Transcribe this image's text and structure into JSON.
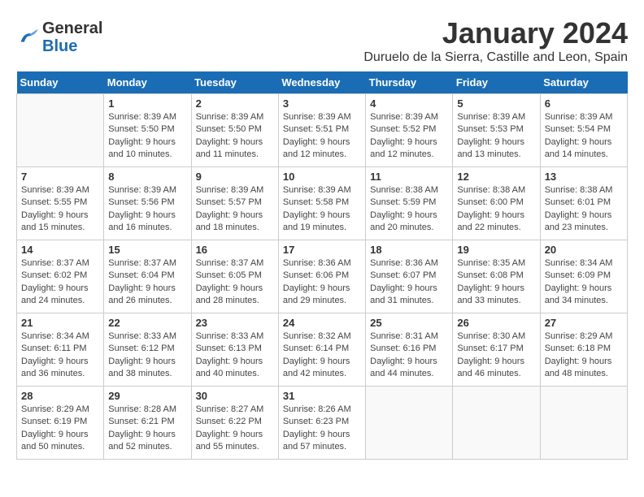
{
  "logo": {
    "text_general": "General",
    "text_blue": "Blue"
  },
  "title": "January 2024",
  "location": "Duruelo de la Sierra, Castille and Leon, Spain",
  "weekdays": [
    "Sunday",
    "Monday",
    "Tuesday",
    "Wednesday",
    "Thursday",
    "Friday",
    "Saturday"
  ],
  "weeks": [
    [
      {
        "day": "",
        "info": ""
      },
      {
        "day": "1",
        "info": "Sunrise: 8:39 AM\nSunset: 5:50 PM\nDaylight: 9 hours\nand 10 minutes."
      },
      {
        "day": "2",
        "info": "Sunrise: 8:39 AM\nSunset: 5:50 PM\nDaylight: 9 hours\nand 11 minutes."
      },
      {
        "day": "3",
        "info": "Sunrise: 8:39 AM\nSunset: 5:51 PM\nDaylight: 9 hours\nand 12 minutes."
      },
      {
        "day": "4",
        "info": "Sunrise: 8:39 AM\nSunset: 5:52 PM\nDaylight: 9 hours\nand 12 minutes."
      },
      {
        "day": "5",
        "info": "Sunrise: 8:39 AM\nSunset: 5:53 PM\nDaylight: 9 hours\nand 13 minutes."
      },
      {
        "day": "6",
        "info": "Sunrise: 8:39 AM\nSunset: 5:54 PM\nDaylight: 9 hours\nand 14 minutes."
      }
    ],
    [
      {
        "day": "7",
        "info": "Sunrise: 8:39 AM\nSunset: 5:55 PM\nDaylight: 9 hours\nand 15 minutes."
      },
      {
        "day": "8",
        "info": "Sunrise: 8:39 AM\nSunset: 5:56 PM\nDaylight: 9 hours\nand 16 minutes."
      },
      {
        "day": "9",
        "info": "Sunrise: 8:39 AM\nSunset: 5:57 PM\nDaylight: 9 hours\nand 18 minutes."
      },
      {
        "day": "10",
        "info": "Sunrise: 8:39 AM\nSunset: 5:58 PM\nDaylight: 9 hours\nand 19 minutes."
      },
      {
        "day": "11",
        "info": "Sunrise: 8:38 AM\nSunset: 5:59 PM\nDaylight: 9 hours\nand 20 minutes."
      },
      {
        "day": "12",
        "info": "Sunrise: 8:38 AM\nSunset: 6:00 PM\nDaylight: 9 hours\nand 22 minutes."
      },
      {
        "day": "13",
        "info": "Sunrise: 8:38 AM\nSunset: 6:01 PM\nDaylight: 9 hours\nand 23 minutes."
      }
    ],
    [
      {
        "day": "14",
        "info": "Sunrise: 8:37 AM\nSunset: 6:02 PM\nDaylight: 9 hours\nand 24 minutes."
      },
      {
        "day": "15",
        "info": "Sunrise: 8:37 AM\nSunset: 6:04 PM\nDaylight: 9 hours\nand 26 minutes."
      },
      {
        "day": "16",
        "info": "Sunrise: 8:37 AM\nSunset: 6:05 PM\nDaylight: 9 hours\nand 28 minutes."
      },
      {
        "day": "17",
        "info": "Sunrise: 8:36 AM\nSunset: 6:06 PM\nDaylight: 9 hours\nand 29 minutes."
      },
      {
        "day": "18",
        "info": "Sunrise: 8:36 AM\nSunset: 6:07 PM\nDaylight: 9 hours\nand 31 minutes."
      },
      {
        "day": "19",
        "info": "Sunrise: 8:35 AM\nSunset: 6:08 PM\nDaylight: 9 hours\nand 33 minutes."
      },
      {
        "day": "20",
        "info": "Sunrise: 8:34 AM\nSunset: 6:09 PM\nDaylight: 9 hours\nand 34 minutes."
      }
    ],
    [
      {
        "day": "21",
        "info": "Sunrise: 8:34 AM\nSunset: 6:11 PM\nDaylight: 9 hours\nand 36 minutes."
      },
      {
        "day": "22",
        "info": "Sunrise: 8:33 AM\nSunset: 6:12 PM\nDaylight: 9 hours\nand 38 minutes."
      },
      {
        "day": "23",
        "info": "Sunrise: 8:33 AM\nSunset: 6:13 PM\nDaylight: 9 hours\nand 40 minutes."
      },
      {
        "day": "24",
        "info": "Sunrise: 8:32 AM\nSunset: 6:14 PM\nDaylight: 9 hours\nand 42 minutes."
      },
      {
        "day": "25",
        "info": "Sunrise: 8:31 AM\nSunset: 6:16 PM\nDaylight: 9 hours\nand 44 minutes."
      },
      {
        "day": "26",
        "info": "Sunrise: 8:30 AM\nSunset: 6:17 PM\nDaylight: 9 hours\nand 46 minutes."
      },
      {
        "day": "27",
        "info": "Sunrise: 8:29 AM\nSunset: 6:18 PM\nDaylight: 9 hours\nand 48 minutes."
      }
    ],
    [
      {
        "day": "28",
        "info": "Sunrise: 8:29 AM\nSunset: 6:19 PM\nDaylight: 9 hours\nand 50 minutes."
      },
      {
        "day": "29",
        "info": "Sunrise: 8:28 AM\nSunset: 6:21 PM\nDaylight: 9 hours\nand 52 minutes."
      },
      {
        "day": "30",
        "info": "Sunrise: 8:27 AM\nSunset: 6:22 PM\nDaylight: 9 hours\nand 55 minutes."
      },
      {
        "day": "31",
        "info": "Sunrise: 8:26 AM\nSunset: 6:23 PM\nDaylight: 9 hours\nand 57 minutes."
      },
      {
        "day": "",
        "info": ""
      },
      {
        "day": "",
        "info": ""
      },
      {
        "day": "",
        "info": ""
      }
    ]
  ]
}
